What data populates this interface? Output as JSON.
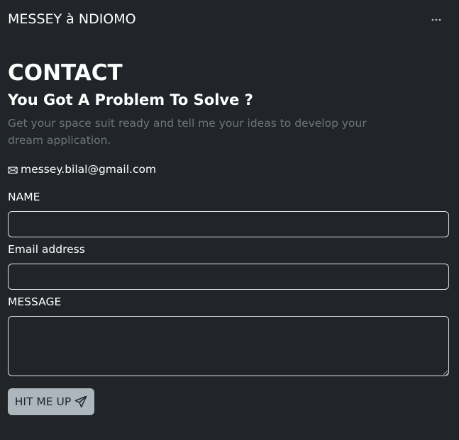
{
  "navbar": {
    "brand": "MESSEY à NDIOMO",
    "menu_icon": "more-horizontal-icon"
  },
  "contact": {
    "title": "CONTACT",
    "subtitle": "You Got A Problem To Solve ?",
    "lead": "Get your space suit ready and tell me your ideas to develop your dream application.",
    "email_icon": "envelope-icon",
    "email": "messey.bilal@gmail.com"
  },
  "form": {
    "name_label": "NAME",
    "name_value": "",
    "email_label": "Email address",
    "email_value": "",
    "message_label": "MESSAGE",
    "message_value": "",
    "submit_label": "HIT ME UP",
    "submit_icon": "send-icon"
  },
  "colors": {
    "background": "#212529",
    "text": "#ffffff",
    "muted": "#6c757d",
    "input_border": "#dee2e6",
    "button_bg": "#adb5bd",
    "button_text": "#212529"
  }
}
